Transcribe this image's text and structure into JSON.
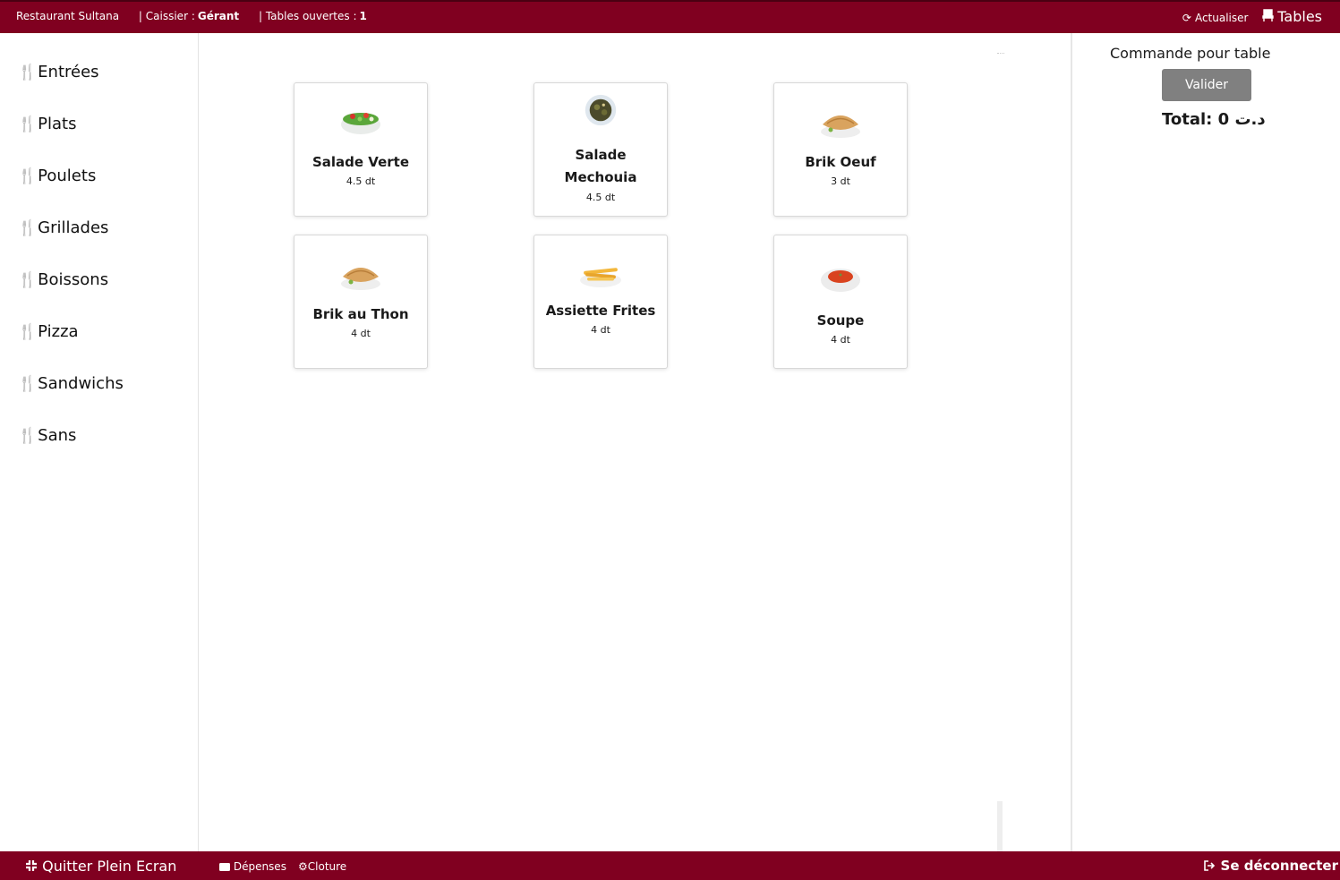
{
  "topbar": {
    "restaurant": "Restaurant Sultana",
    "cashier_label": "| Caissier :",
    "cashier_name": "Gérant",
    "tables_open_label": "| Tables ouvertes :",
    "tables_open_count": "1",
    "refresh_label": "Actualiser",
    "tables_label": "Tables"
  },
  "sidebar": {
    "items": [
      {
        "label": "Entrées"
      },
      {
        "label": "Plats"
      },
      {
        "label": "Poulets"
      },
      {
        "label": "Grillades"
      },
      {
        "label": "Boissons"
      },
      {
        "label": "Pizza"
      },
      {
        "label": "Sandwichs"
      },
      {
        "label": "Sans"
      }
    ]
  },
  "products": [
    {
      "name": "Salade Verte",
      "price": "4.5 dt",
      "image": "salad-bowl"
    },
    {
      "name": "Salade Mechouia",
      "price": "4.5 dt",
      "image": "mechouia-plate"
    },
    {
      "name": "Brik Oeuf",
      "price": "3 dt",
      "image": "brik-pastry"
    },
    {
      "name": "Brik au Thon",
      "price": "4 dt",
      "image": "brik-pastry"
    },
    {
      "name": "Assiette Frites",
      "price": "4 dt",
      "image": "fries-plate"
    },
    {
      "name": "Soupe",
      "price": "4 dt",
      "image": "soup-bowl"
    }
  ],
  "order": {
    "title": "Commande pour table",
    "validate_label": "Valider",
    "total_label": "Total: 0 د.ت"
  },
  "bottombar": {
    "fullscreen_label": "Quitter Plein Ecran",
    "expenses_label": "Dépenses",
    "closing_label": "Cloture",
    "logout_label": "Se déconnecter"
  },
  "colors": {
    "bar": "#800020",
    "validate_button": "#808080"
  }
}
